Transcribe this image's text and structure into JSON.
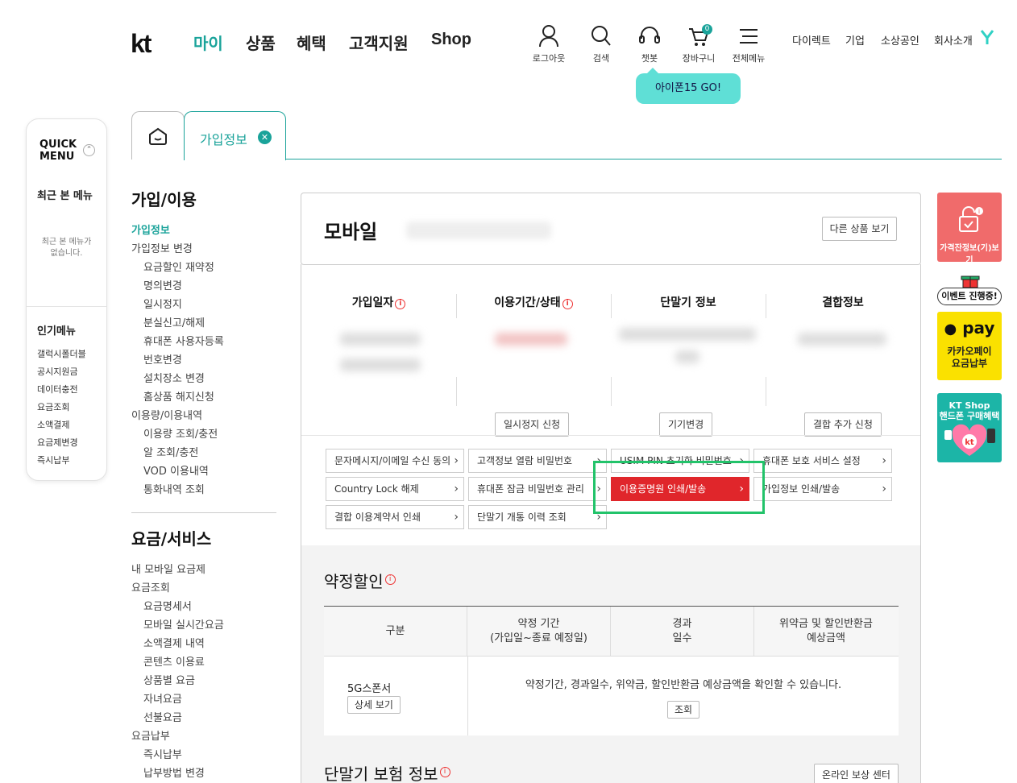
{
  "header": {
    "logo": "kt",
    "gnb": [
      "마이",
      "상품",
      "혜택",
      "고객지원",
      "Shop"
    ],
    "utils": [
      "로그아웃",
      "검색",
      "챗봇",
      "장바구니",
      "전체메뉴"
    ],
    "cart_count": "0",
    "top_links": [
      "다이렉트",
      "기업",
      "소상공인",
      "회사소개"
    ],
    "bubble": "아이폰15 GO!"
  },
  "quick": {
    "title": "QUICK MENU",
    "recent_title": "최근 본 메뉴",
    "recent_empty": "최근 본 메뉴가 없습니다.",
    "popular_title": "인기메뉴",
    "popular": [
      "갤럭시폴더블",
      "공시지원금",
      "데이터충전",
      "요금조회",
      "소액결제",
      "요금제변경",
      "즉시납부"
    ]
  },
  "tabs": {
    "active": "가입정보"
  },
  "lnav": {
    "sec1_title": "가입/이용",
    "sec1": [
      {
        "label": "가입정보",
        "level": 1,
        "on": true
      },
      {
        "label": "가입정보 변경",
        "level": 1
      },
      {
        "label": "요금할인 재약정",
        "level": 2
      },
      {
        "label": "명의변경",
        "level": 2
      },
      {
        "label": "일시정지",
        "level": 2
      },
      {
        "label": "분실신고/해제",
        "level": 2
      },
      {
        "label": "휴대폰 사용자등록",
        "level": 2
      },
      {
        "label": "번호변경",
        "level": 2
      },
      {
        "label": "설치장소 변경",
        "level": 2
      },
      {
        "label": "홈상품 해지신청",
        "level": 2
      },
      {
        "label": "이용량/이용내역",
        "level": 1
      },
      {
        "label": "이용량 조회/충전",
        "level": 2
      },
      {
        "label": "알 조회/충전",
        "level": 2
      },
      {
        "label": "VOD 이용내역",
        "level": 2
      },
      {
        "label": "통화내역 조회",
        "level": 2
      }
    ],
    "sec2_title": "요금/서비스",
    "sec2": [
      {
        "label": "내 모바일 요금제",
        "level": 1
      },
      {
        "label": "요금조회",
        "level": 1
      },
      {
        "label": "요금명세서",
        "level": 2
      },
      {
        "label": "모바일 실시간요금",
        "level": 2
      },
      {
        "label": "소액결제 내역",
        "level": 2
      },
      {
        "label": "콘텐츠 이용료",
        "level": 2
      },
      {
        "label": "상품별 요금",
        "level": 2
      },
      {
        "label": "자녀요금",
        "level": 2
      },
      {
        "label": "선불요금",
        "level": 2
      },
      {
        "label": "요금납부",
        "level": 1
      },
      {
        "label": "즉시납부",
        "level": 2
      },
      {
        "label": "납부방법 변경",
        "level": 2
      }
    ]
  },
  "main": {
    "title": "모바일",
    "other_btn": "다른 상품 보기",
    "cols": [
      {
        "h": "가입일자",
        "info": true,
        "action": ""
      },
      {
        "h": "이용기간/상태",
        "info": true,
        "action": "일시정지 신청"
      },
      {
        "h": "단말기 정보",
        "info": false,
        "action": "기기변경"
      },
      {
        "h": "결합정보",
        "info": false,
        "action": "결합 추가 신청"
      }
    ],
    "links": [
      "문자메시지/이메일 수신 동의",
      "고객정보 열람 비밀번호",
      "USIM PIN 초기화 비밀번호",
      "휴대폰 보호 서비스 설정",
      "Country Lock 해제",
      "휴대폰 잠금 비밀번호 관리",
      "이용증명원 인쇄/발송",
      "가입정보 인쇄/발송",
      "결합 이용계약서 인쇄",
      "단말기 개통 이력 조회"
    ]
  },
  "discount": {
    "title": "약정할인",
    "headers": [
      "구분",
      "약정 기간\n(가입일~종료 예정일)",
      "경과\n일수",
      "위약금 및 할인반환금\n예상금액"
    ],
    "plan": "5G스폰서",
    "detail_btn": "상세 보기",
    "message": "약정기간, 경과일수, 위약금, 할인반환금 예상금액을 확인할 수 있습니다.",
    "query_btn": "조회"
  },
  "insurance": {
    "title": "단말기 보험 정보",
    "btn": "온라인 보상 센터"
  },
  "banners": {
    "b1": "가격잔정보(기)보기",
    "event": "이벤트 진행중!",
    "pay": "pay",
    "b2": "카카오페이\n요금납부",
    "b3": "KT Shop\n핸드폰 구매혜택"
  },
  "colors": {
    "accent": "#1aa39a",
    "red": "#e0262b",
    "highlight": "#22c36a"
  }
}
